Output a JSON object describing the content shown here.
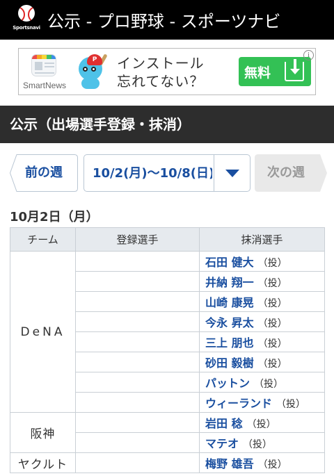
{
  "header": {
    "logo_text": "Sportsnavi",
    "title": "公示 - プロ野球 - スポーツナビ"
  },
  "ad": {
    "brand": "SmartNews",
    "mascot_cap": "P",
    "text_line1": "インストール",
    "text_line2": "忘れてない？",
    "button_label": "無料",
    "info_icon": "i"
  },
  "section_title": "公示（出場選手登録・抹消）",
  "week_nav": {
    "prev_label": "前の週",
    "selected_range": "10/2(月)〜10/8(日)",
    "next_label": "次の週"
  },
  "date_heading": "10月2日（月）",
  "table": {
    "headers": [
      "チーム",
      "登録選手",
      "抹消選手"
    ],
    "teams": [
      {
        "name": "DeNA",
        "removed": [
          {
            "name": "石田 健大",
            "pos": "（投）"
          },
          {
            "name": "井納 翔一",
            "pos": "（投）"
          },
          {
            "name": "山崎 康晃",
            "pos": "（投）"
          },
          {
            "name": "今永 昇太",
            "pos": "（投）"
          },
          {
            "name": "三上 朋也",
            "pos": "（投）"
          },
          {
            "name": "砂田 毅樹",
            "pos": "（投）"
          },
          {
            "name": "パットン",
            "pos": "（投）"
          },
          {
            "name": "ウィーランド",
            "pos": "（投）"
          }
        ]
      },
      {
        "name": "阪神",
        "removed": [
          {
            "name": "岩田 稔",
            "pos": "（投）"
          },
          {
            "name": "マテオ",
            "pos": "（投）"
          }
        ]
      },
      {
        "name": "ヤクルト",
        "removed": [
          {
            "name": "梅野 雄吾",
            "pos": "（投）"
          }
        ]
      }
    ]
  },
  "colors": {
    "topbar": "#000000",
    "section_bg": "#2d2d2d",
    "link_blue": "#1a4fa0",
    "ad_button": "#33c155",
    "table_header_bg": "#e6eaee",
    "border": "#c9cfd5"
  },
  "icons": {
    "logo": "baseball-logo-icon",
    "ad_download": "download-icon",
    "dropdown": "chevron-down-icon",
    "ad_info": "info-icon"
  }
}
